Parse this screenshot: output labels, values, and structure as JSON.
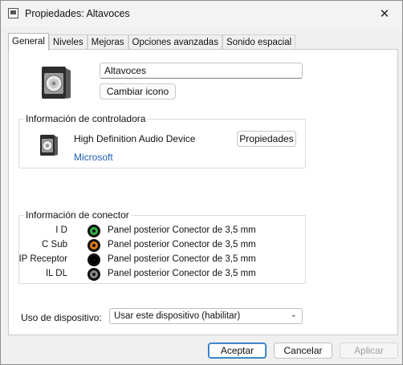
{
  "window": {
    "title": "Propiedades: Altavoces",
    "close_glyph": "✕"
  },
  "tabs": [
    {
      "label": "General",
      "active": true
    },
    {
      "label": "Niveles"
    },
    {
      "label": "Mejoras"
    },
    {
      "label": "Opciones avanzadas"
    },
    {
      "label": "Sonido espacial"
    }
  ],
  "general": {
    "device_name": "Altavoces",
    "change_icon_label": "Cambiar icono",
    "controller_group": {
      "title": "Información de controladora",
      "device": "High Definition Audio Device",
      "properties_label": "Propiedades",
      "manufacturer": "Microsoft"
    },
    "connector_group": {
      "title": "Información de conector",
      "rows": [
        {
          "label": "I D",
          "color": "#2fb344",
          "description": "Panel posterior Conector de 3,5 mm"
        },
        {
          "label": "C Sub",
          "color": "#e07a1f",
          "description": "Panel posterior Conector de 3,5 mm"
        },
        {
          "label": "IP Receptor",
          "color": "#000000",
          "description": "Panel posterior Conector de 3,5 mm"
        },
        {
          "label": "IL DL",
          "color": "#8a8a8a",
          "description": "Panel posterior Conector de 3,5 mm"
        }
      ]
    },
    "device_usage": {
      "label": "Uso de dispositivo:",
      "selected": "Usar este dispositivo (habilitar)"
    }
  },
  "footer": {
    "accept_label": "Aceptar",
    "cancel_label": "Cancelar",
    "apply_label": "Aplicar"
  }
}
